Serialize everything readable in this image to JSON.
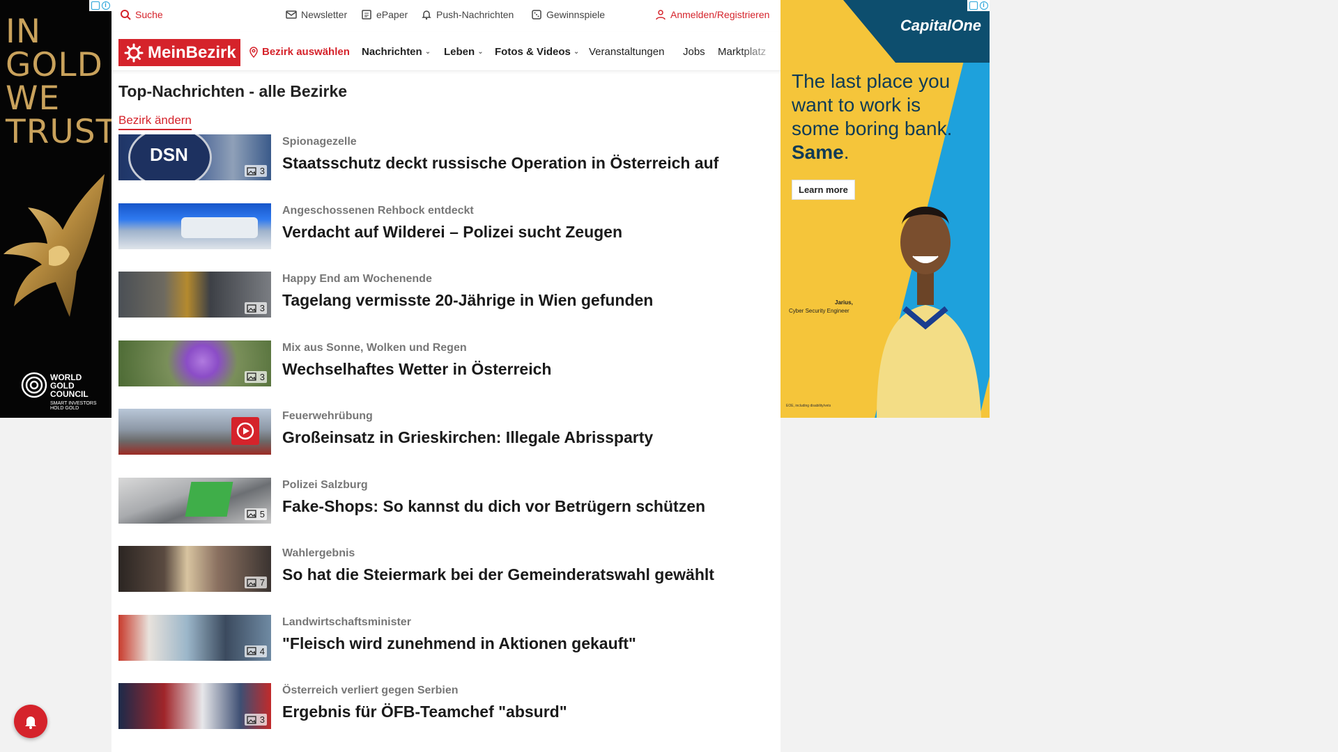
{
  "ads": {
    "left": {
      "headline": "IN\nGOLD\nWE\nTRUST",
      "org_name": "WORLD\nGOLD\nCOUNCIL",
      "org_tagline": "SMART INVESTORS\nHOLD GOLD"
    },
    "right": {
      "brand": "CapitalOne",
      "copy": "The last place you want to work is some boring bank.",
      "copy_emphasis": "Same",
      "copy_end": ".",
      "cta": "Learn more",
      "person_name": "Jarius,",
      "person_role": "Cyber Security Engineer",
      "legal": "EOE, including disability/vets"
    }
  },
  "topbar": {
    "search": "Suche",
    "newsletter": "Newsletter",
    "epaper": "ePaper",
    "push": "Push-Nachrichten",
    "contests": "Gewinnspiele",
    "login": "Anmelden/Registrieren"
  },
  "nav": {
    "logo": "MeinBezirk",
    "bezirk": "Bezirk auswählen",
    "items": [
      "Nachrichten",
      "Leben",
      "Fotos & Videos",
      "Veranstaltungen",
      "Jobs",
      "Marktplatz"
    ]
  },
  "page": {
    "title": "Top-Nachrichten - alle Bezirke",
    "change_link": "Bezirk ändern"
  },
  "articles": [
    {
      "kicker": "Spionagezelle",
      "headline": "Staatsschutz deckt russische Operation in Österreich auf",
      "count": "3"
    },
    {
      "kicker": "Angeschossenen Rehbock entdeckt",
      "headline": "Verdacht auf Wilderei – Polizei sucht Zeugen",
      "count": ""
    },
    {
      "kicker": "Happy End am Wochenende",
      "headline": "Tagelang vermisste 20-Jährige in Wien gefunden",
      "count": "3"
    },
    {
      "kicker": "Mix aus Sonne, Wolken und Regen",
      "headline": "Wechselhaftes Wetter in Österreich",
      "count": "3"
    },
    {
      "kicker": "Feuerwehrübung",
      "headline": "Großeinsatz in Grieskirchen: Illegale Abrissparty",
      "count": ""
    },
    {
      "kicker": "Polizei Salzburg",
      "headline": "Fake-Shops: So kannst du dich vor Betrügern schützen",
      "count": "5"
    },
    {
      "kicker": "Wahlergebnis",
      "headline": "So hat die Steiermark bei der Gemeinderatswahl gewählt",
      "count": "7"
    },
    {
      "kicker": "Landwirtschaftsminister",
      "headline": "\"Fleisch wird zunehmend in Aktionen gekauft\"",
      "count": "4"
    },
    {
      "kicker": "Österreich verliert gegen Serbien",
      "headline": "Ergebnis für ÖFB-Teamchef \"absurd\"",
      "count": "3"
    }
  ],
  "thumb_text": {
    "dsn": "DSN"
  },
  "colors": {
    "brand_red": "#d5232b",
    "gold": "#c9a25c",
    "capital_one_yellow": "#f5c53a",
    "capital_one_blue": "#1ea1dc"
  }
}
